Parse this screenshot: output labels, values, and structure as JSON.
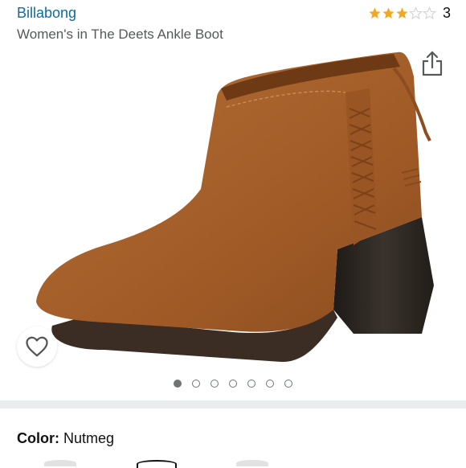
{
  "header": {
    "brand": "Billabong",
    "title": "Women's in The Deets Ankle Boot"
  },
  "rating": {
    "stars": 3,
    "max": 5,
    "count": "3",
    "star_color": "#f5a623"
  },
  "icons": {
    "share": "share-icon",
    "wishlist": "heart-outline-icon"
  },
  "gallery": {
    "image_count": 7,
    "active_index": 0,
    "image_alt": "tan suede ankle boot"
  },
  "color": {
    "label": "Color:",
    "value": "Nutmeg"
  },
  "colors": {
    "brand_link": "#0f6b9c",
    "boot": "#a9642f",
    "heel": "#2b2622"
  }
}
